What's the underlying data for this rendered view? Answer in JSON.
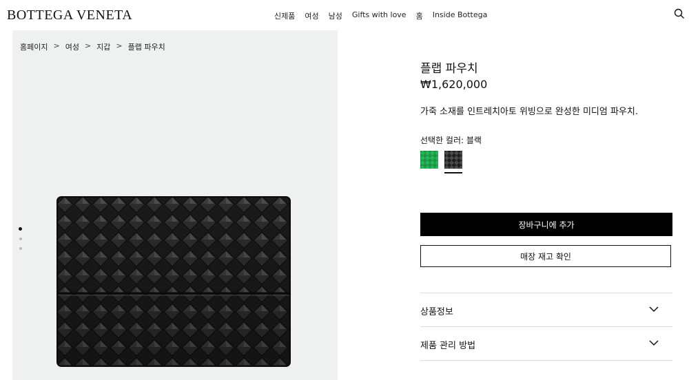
{
  "header": {
    "logo": "BOTTEGA VENETA",
    "nav": [
      "신제품",
      "여성",
      "남성",
      "Gifts with love",
      "홈",
      "Inside Bottega"
    ]
  },
  "breadcrumb": [
    "홈페이지",
    "여성",
    "지갑",
    "플랩 파우치"
  ],
  "breadcrumb_separator": ">",
  "gallery": {
    "image_count": 3,
    "active_index": 0
  },
  "product": {
    "name": "플랩 파우치",
    "price": "₩1,620,000",
    "description": "가죽 소재를 인트레치아토 위빙으로 완성한 미디엄 파우치.",
    "color_label": "선택한 컬러: 블랙",
    "swatches": [
      {
        "name": "green",
        "color": "#1f9a4a"
      },
      {
        "name": "black",
        "color": "#2a2a2a",
        "selected": true
      }
    ]
  },
  "actions": {
    "add_to_cart": "장바구니에 추가",
    "check_stock": "매장 재고 확인"
  },
  "accordion": [
    {
      "label": "상품정보"
    },
    {
      "label": "제품 관리 방법"
    }
  ]
}
